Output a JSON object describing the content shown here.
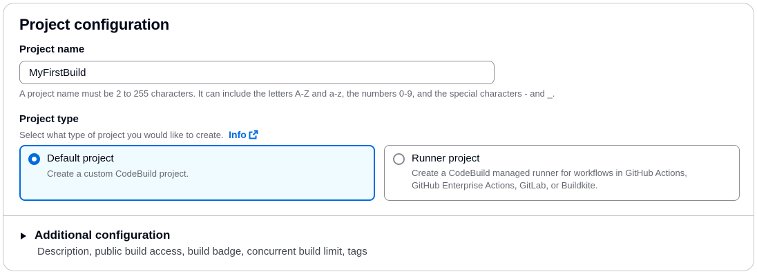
{
  "section": {
    "title": "Project configuration"
  },
  "project_name": {
    "label": "Project name",
    "value": "MyFirstBuild",
    "hint": "A project name must be 2 to 255 characters. It can include the letters A-Z and a-z, the numbers 0-9, and the special characters - and _."
  },
  "project_type": {
    "label": "Project type",
    "hint": "Select what type of project you would like to create.",
    "info_link": "Info",
    "options": [
      {
        "title": "Default project",
        "description": "Create a custom CodeBuild project.",
        "selected": true
      },
      {
        "title": "Runner project",
        "description": "Create a CodeBuild managed runner for workflows in GitHub Actions, GitHub Enterprise Actions, GitLab, or Buildkite.",
        "selected": false
      }
    ]
  },
  "additional_configuration": {
    "title": "Additional configuration",
    "description": "Description, public build access, build badge, concurrent build limit, tags",
    "expanded": false
  },
  "colors": {
    "accent": "#006ce0",
    "selected_bg": "#f0fbff",
    "border": "#c6c6cd",
    "text": "#000716",
    "muted": "#656871"
  },
  "icons": {
    "info_external": "external-link-icon",
    "expander": "caret-right-icon"
  }
}
